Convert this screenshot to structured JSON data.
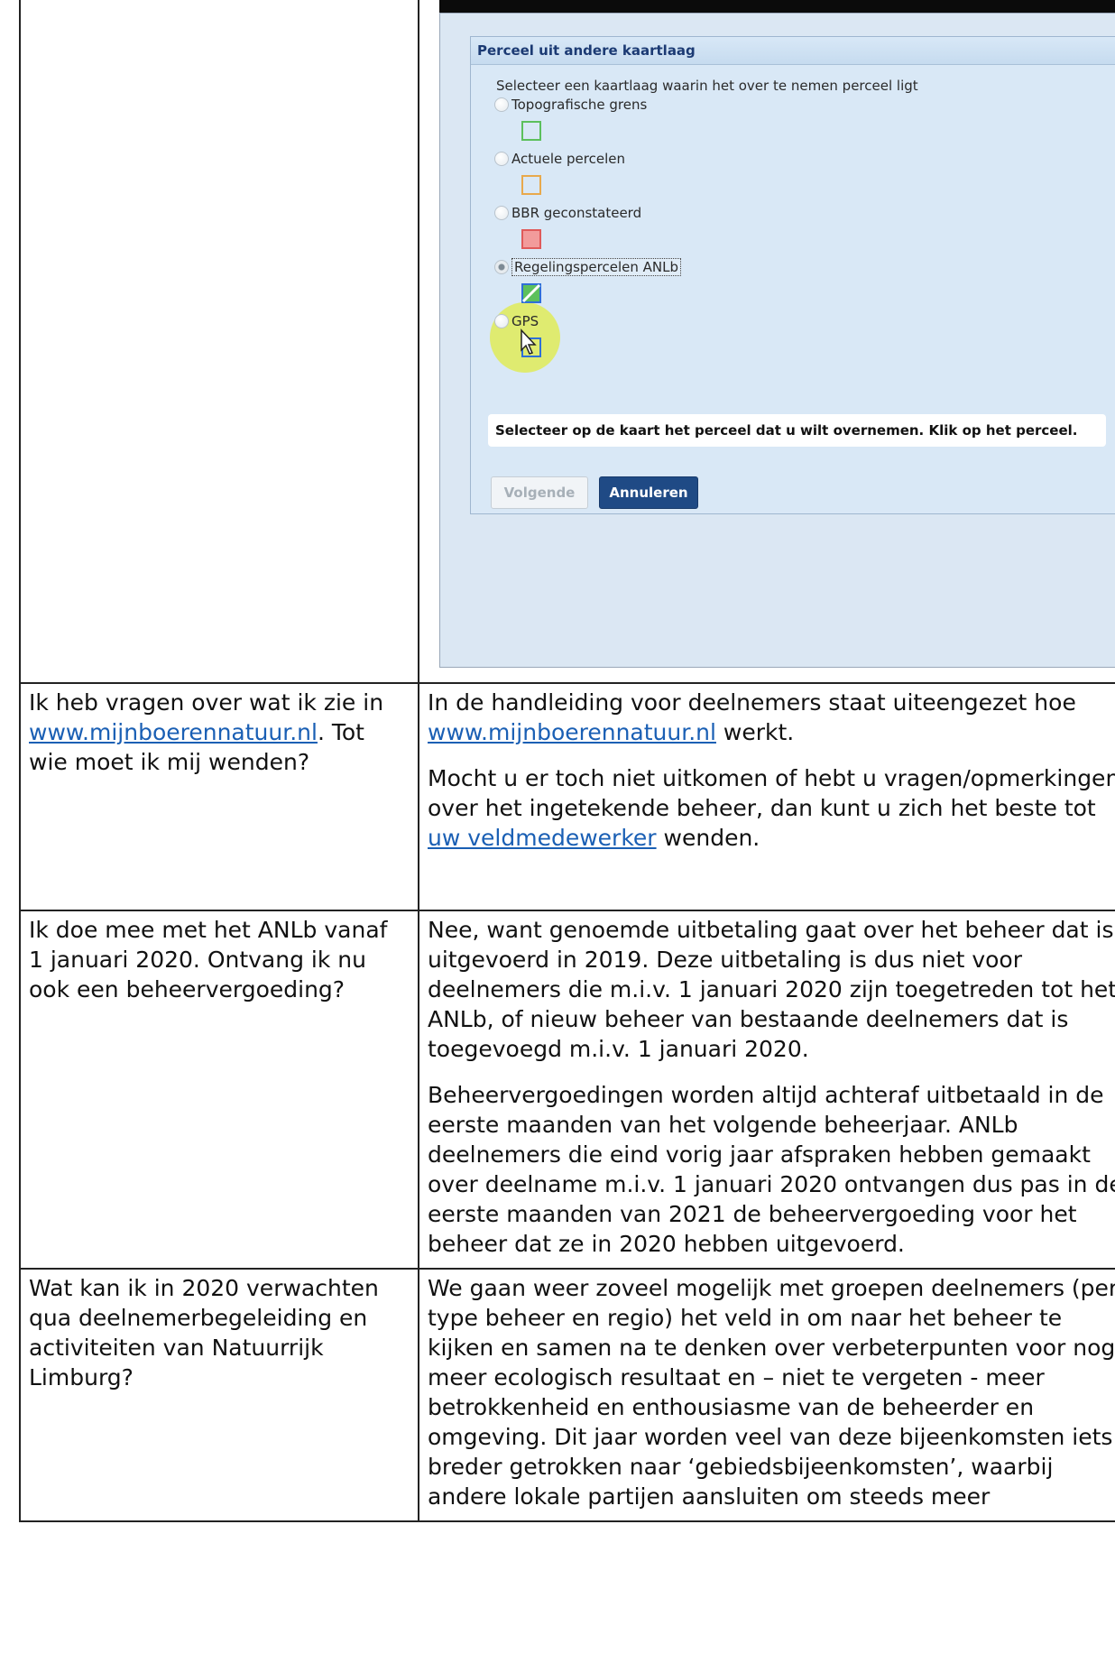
{
  "screenshot": {
    "panel_title": "Perceel uit andere kaartlaag",
    "intro": "Selecteer een kaartlaag waarin het over te nemen perceel ligt",
    "options": [
      {
        "label": "Topografische grens",
        "border": "#5cc05c",
        "fill": "transparent",
        "selected": false
      },
      {
        "label": "Actuele percelen",
        "border": "#e8a94c",
        "fill": "transparent",
        "selected": false
      },
      {
        "label": "BBR geconstateerd",
        "border": "#e05a5a",
        "fill": "#f29b9b",
        "selected": false
      },
      {
        "label": "Regelingspercelen ANLb",
        "border": "#2f6fd8",
        "fill": "#5cc05c",
        "selected": true
      },
      {
        "label": "GPS",
        "border": "#2f6fd8",
        "fill": "transparent",
        "selected": false
      }
    ],
    "notice": "Selecteer op de kaart het perceel dat u wilt overnemen. Klik op het perceel.",
    "btn_next": "Volgende",
    "btn_cancel": "Annuleren"
  },
  "rows": [
    {
      "q_pre": "Ik heb vragen over wat ik zie in ",
      "q_link": "www.mijnboerennatuur.nl",
      "q_post": ". Tot wie moet ik mij wenden?",
      "a1_pre": "In de handleiding voor deelnemers staat uiteengezet hoe ",
      "a1_link": "www.mijnboerennatuur.nl",
      "a1_post": " werkt.",
      "a2_pre": "Mocht u er toch niet uitkomen of hebt u vragen/opmerkingen over het ingetekende beheer, dan kunt u zich het beste tot ",
      "a2_link": "uw veldmedewerker",
      "a2_post": " wenden."
    },
    {
      "q": "Ik doe mee met het ANLb vanaf 1 januari 2020. Ontvang ik nu ook een beheervergoeding?",
      "a1": "Nee, want genoemde uitbetaling gaat over het beheer dat is uitgevoerd in 2019. Deze uitbetaling is dus niet voor deelnemers die m.i.v. 1 januari 2020 zijn toegetreden tot het ANLb, of nieuw beheer van bestaande deelnemers dat is toegevoegd m.i.v. 1 januari 2020.",
      "a2": "Beheervergoedingen worden altijd achteraf uitbetaald in de eerste maanden van het volgende beheerjaar. ANLb deelnemers die eind vorig jaar afspraken hebben gemaakt over deelname m.i.v. 1 januari 2020 ontvangen dus pas in de eerste maanden van 2021 de beheervergoeding voor het beheer dat ze in 2020 hebben uitgevoerd."
    },
    {
      "q": "Wat kan ik in 2020 verwachten qua deelnemerbegeleiding en activiteiten van Natuurrijk Limburg?",
      "a1": "We gaan weer zoveel mogelijk met groepen deelnemers (per type beheer en regio) het veld in om naar het beheer te kijken en samen na te denken over verbeterpunten voor nog meer ecologisch resultaat en – niet te vergeten - meer betrokkenheid en enthousiasme van de beheerder en omgeving. Dit jaar worden veel van deze bijeenkomsten iets breder getrokken naar ‘gebiedsbijeenkomsten’, waarbij andere lokale partijen aansluiten om steeds meer"
    }
  ]
}
